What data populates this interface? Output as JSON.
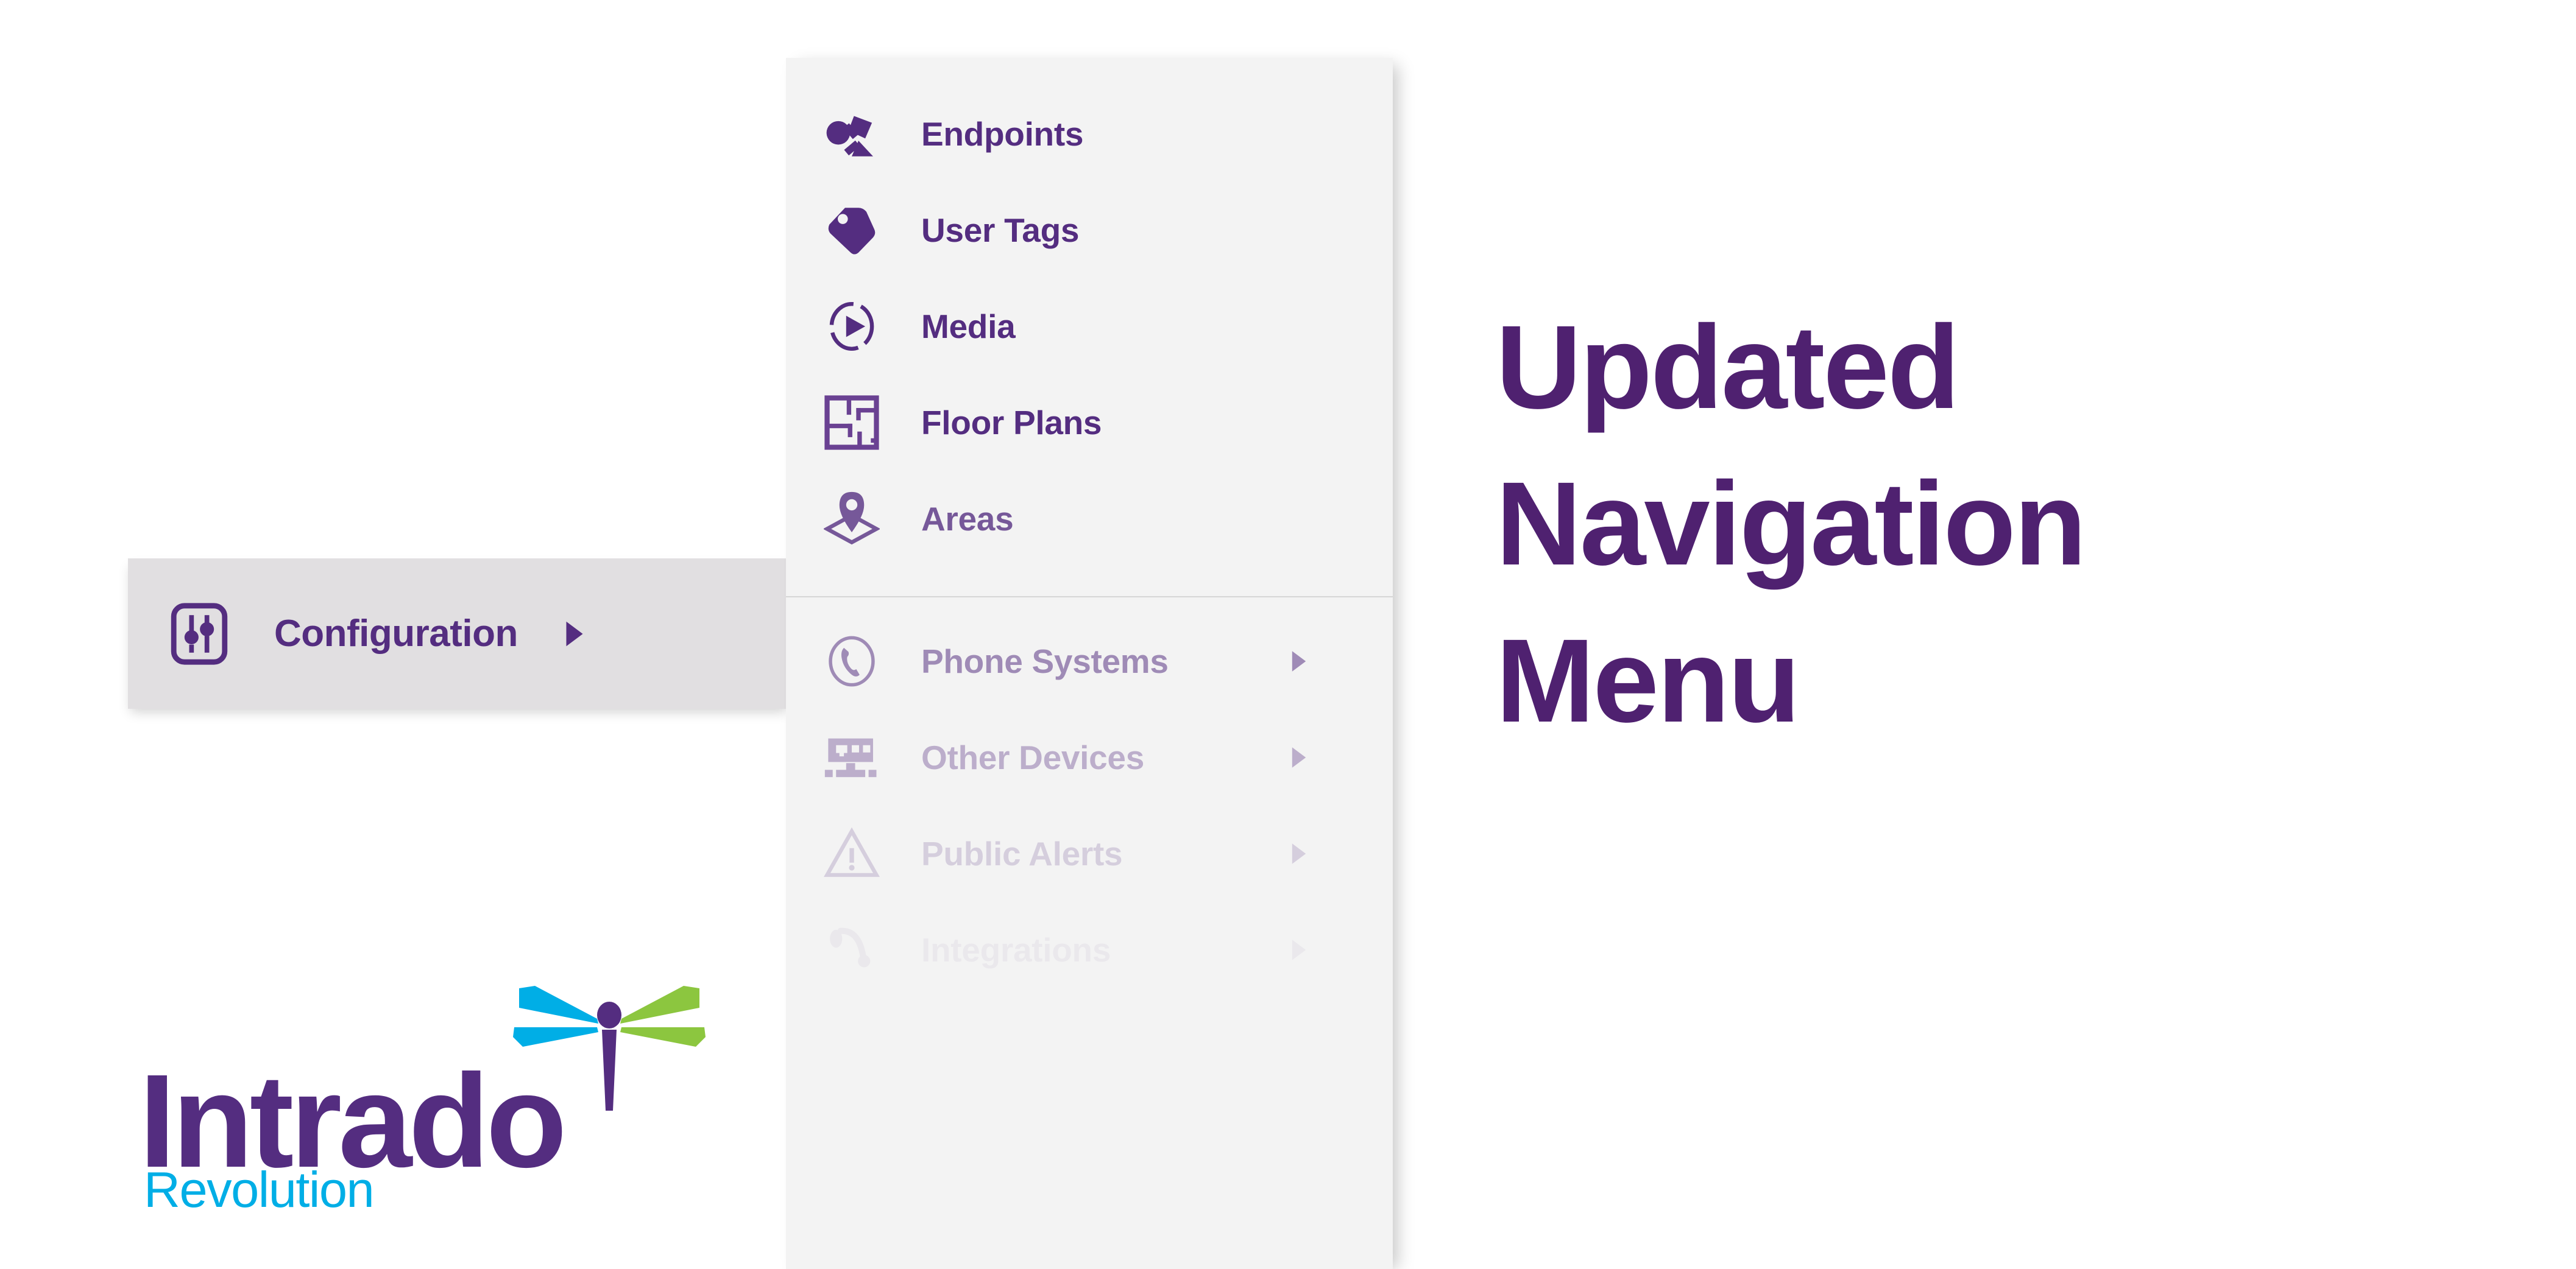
{
  "brand": {
    "purple": "#542d80",
    "headline_purple": "#4f2170",
    "cyan": "#00aee6",
    "green": "#8cc63f",
    "panel_bg": "#f3f3f3",
    "config_bar_bg": "#e1dfe1"
  },
  "config_bar": {
    "label": "Configuration",
    "icon": "sliders-icon",
    "caret": "chevron-right-icon"
  },
  "menu": {
    "primary_items": [
      {
        "label": "Endpoints",
        "icon": "share-network-icon",
        "has_submenu": false
      },
      {
        "label": "User Tags",
        "icon": "tag-icon",
        "has_submenu": false
      },
      {
        "label": "Media",
        "icon": "play-circle-icon",
        "has_submenu": false
      },
      {
        "label": "Floor Plans",
        "icon": "floor-plan-icon",
        "has_submenu": false
      },
      {
        "label": "Areas",
        "icon": "map-pin-icon",
        "has_submenu": false
      }
    ],
    "secondary_items": [
      {
        "label": "Phone Systems",
        "icon": "phone-circle-icon",
        "has_submenu": true,
        "caret": "chevron-right-icon"
      },
      {
        "label": "Other Devices",
        "icon": "network-switch-icon",
        "has_submenu": true,
        "caret": "chevron-right-icon"
      },
      {
        "label": "Public Alerts",
        "icon": "warning-icon",
        "has_submenu": true,
        "caret": "chevron-right-icon"
      },
      {
        "label": "Integrations",
        "icon": "integrations-icon",
        "has_submenu": true,
        "caret": "chevron-right-icon"
      }
    ]
  },
  "headline": {
    "line1": "Updated",
    "line2": "Navigation",
    "line3": "Menu"
  },
  "logo": {
    "wordmark": "Intrado",
    "tagline": "Revolution",
    "mark": "dragonfly-icon"
  }
}
